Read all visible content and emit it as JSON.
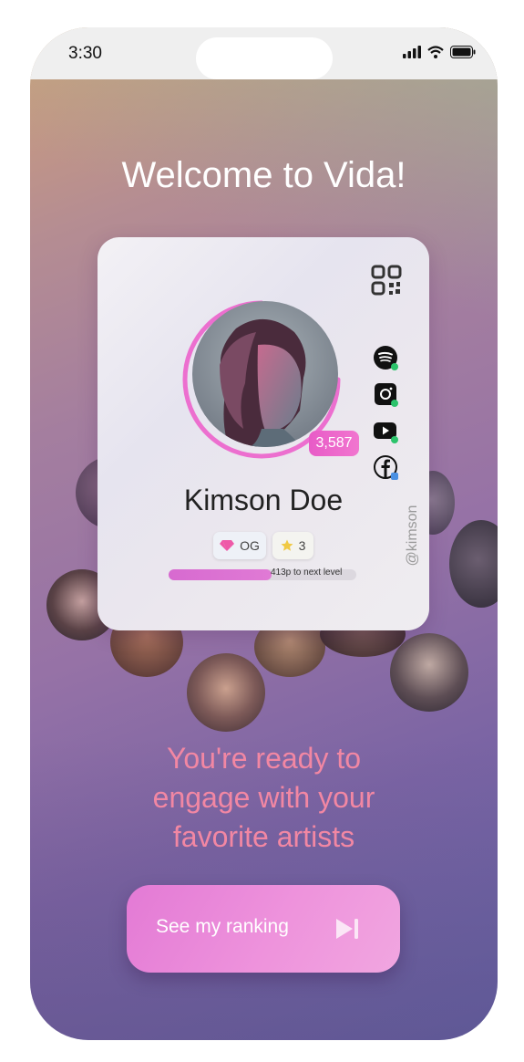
{
  "status_bar": {
    "time": "3:30",
    "icons": [
      "signal-icon",
      "wifi-icon",
      "battery-icon"
    ]
  },
  "welcome_title": "Welcome to Vida!",
  "profile_card": {
    "name": "Kimson Doe",
    "score": "3,587",
    "handle": "@kimson",
    "badges": [
      {
        "icon": "gem-icon",
        "label": "OG"
      },
      {
        "icon": "star-icon",
        "label": "3"
      }
    ],
    "progress": {
      "fraction": 0.55,
      "label": "413p to next level"
    },
    "ring_progress_fraction": 0.75,
    "qr_icon": "qr-code-icon",
    "socials": [
      {
        "icon": "spotify-icon",
        "verified": true
      },
      {
        "icon": "instagram-icon",
        "verified": true
      },
      {
        "icon": "youtube-icon",
        "verified": true
      },
      {
        "icon": "facebook-icon",
        "verified": true
      }
    ]
  },
  "tagline": [
    "You're ready to",
    "engage with your",
    "favorite artists"
  ],
  "cta": {
    "label": "See my ranking",
    "icon": "skip-forward-icon"
  },
  "colors": {
    "accent": "#e85bc7",
    "tagline": "#f287a3",
    "cta_start": "#e37ad5",
    "cta_end": "#f1a6e0"
  }
}
